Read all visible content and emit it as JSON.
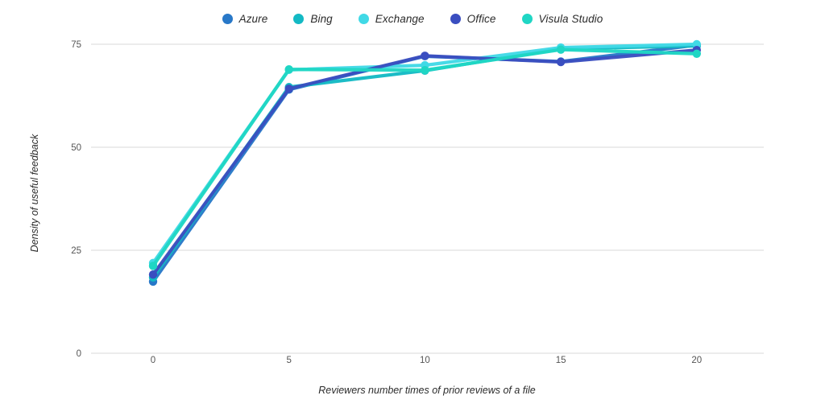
{
  "chart_data": {
    "type": "line",
    "title": "",
    "xlabel": "Reviewers number times of prior reviews of a file",
    "ylabel": "Density of useful feedback",
    "x": [
      0,
      5,
      10,
      15,
      20
    ],
    "xticklabels": [
      "0",
      "5",
      "10",
      "15",
      "20"
    ],
    "yticklabels": [
      "0",
      "25",
      "50",
      "75"
    ],
    "yticks": [
      0,
      25,
      50,
      75
    ],
    "xlim": [
      -1.5,
      21.5
    ],
    "ylim": [
      0,
      80
    ],
    "grid": "horizontal",
    "legend_position": "top-center",
    "markers": "circle",
    "series": [
      {
        "name": "Azure",
        "color": "#2878c8",
        "values": [
          17.4,
          64.0,
          72.1,
          70.8,
          74.8
        ]
      },
      {
        "name": "Bing",
        "color": "#13b9c4",
        "values": [
          18.4,
          64.6,
          68.6,
          73.9,
          74.6
        ]
      },
      {
        "name": "Exchange",
        "color": "#41d9e6",
        "values": [
          21.9,
          68.8,
          69.9,
          74.2,
          75.0
        ]
      },
      {
        "name": "Office",
        "color": "#3a4ec0",
        "values": [
          19.1,
          64.2,
          72.2,
          70.7,
          73.6
        ]
      },
      {
        "name": "Visula Studio",
        "color": "#1fd6c4",
        "values": [
          21.2,
          68.9,
          68.7,
          73.7,
          72.7
        ]
      }
    ]
  }
}
